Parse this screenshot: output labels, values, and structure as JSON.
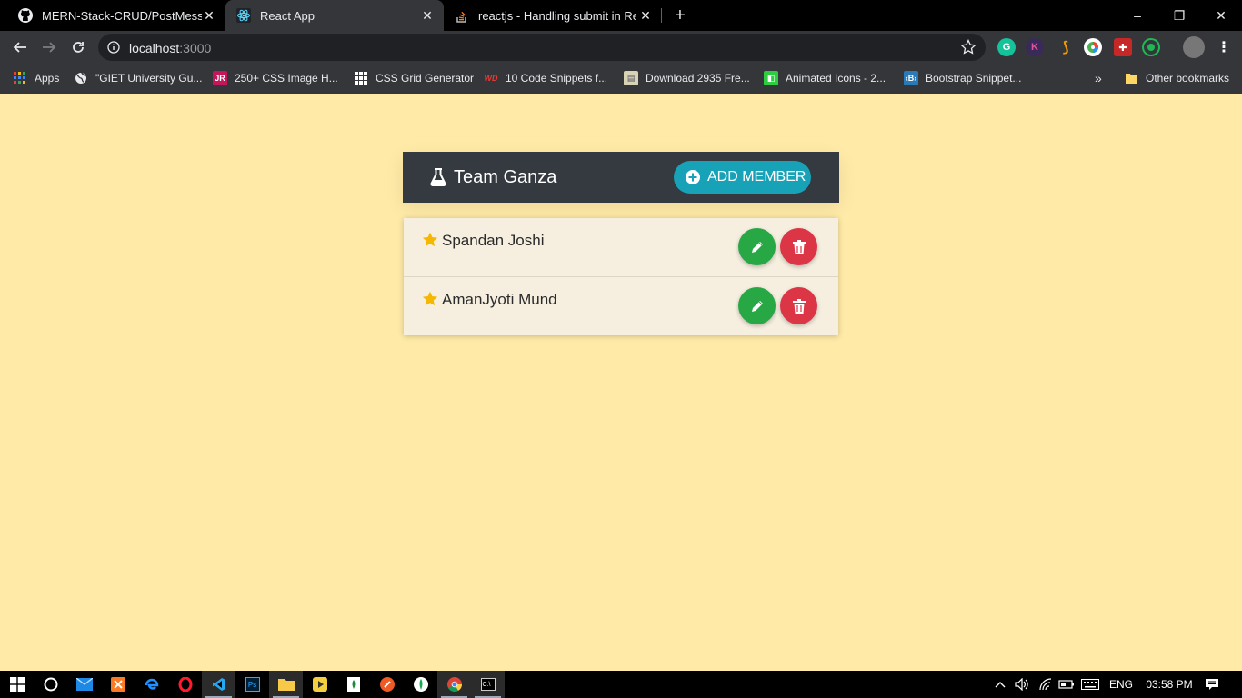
{
  "browser": {
    "tabs": [
      {
        "title": "MERN-Stack-CRUD/PostMessage",
        "active": false,
        "icon": "github-icon"
      },
      {
        "title": "React App",
        "active": true,
        "icon": "react-icon"
      },
      {
        "title": "reactjs - Handling submit in React",
        "active": false,
        "icon": "stackoverflow-icon"
      }
    ],
    "new_tab_label": "+",
    "window_controls": {
      "minimize": "–",
      "restore": "❐",
      "close": "✕"
    },
    "address": {
      "host": "localhost",
      "port": ":3000"
    },
    "bookmarks": [
      {
        "label": "Apps",
        "icon": "apps-grid-icon"
      },
      {
        "label": "\"GIET University Gu...",
        "icon": "globe-icon"
      },
      {
        "label": "250+ CSS Image H...",
        "icon": "jr-icon"
      },
      {
        "label": "CSS Grid Generator",
        "icon": "grid-icon"
      },
      {
        "label": "10 Code Snippets f...",
        "icon": "wd-icon"
      },
      {
        "label": "Download 2935 Fre...",
        "icon": "download-icon"
      },
      {
        "label": "Animated Icons - 2...",
        "icon": "animated-icons-icon"
      },
      {
        "label": "Bootstrap Snippet...",
        "icon": "bootstrap-icon"
      }
    ],
    "bookmarks_overflow": "»",
    "other_bookmarks": "Other bookmarks"
  },
  "app": {
    "team_name": "Team Ganza",
    "add_button_label": "ADD MEMBER",
    "members": [
      {
        "name": "Spandan Joshi"
      },
      {
        "name": "AmanJyoti Mund"
      }
    ],
    "colors": {
      "background": "#ffeaa7",
      "header": "#343a40",
      "add_button": "#17a2b8",
      "edit_button": "#28a745",
      "delete_button": "#dc3545",
      "star": "#f5b700"
    }
  },
  "taskbar": {
    "language": "ENG",
    "time": "03:58 PM"
  }
}
